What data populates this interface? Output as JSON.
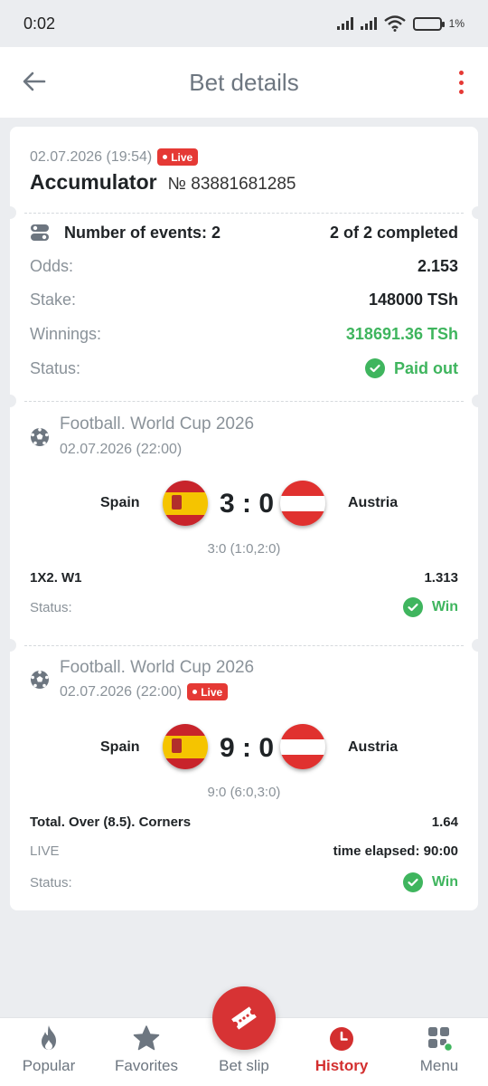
{
  "status_bar": {
    "time": "0:02",
    "battery": "1%"
  },
  "header": {
    "title": "Bet details"
  },
  "bet": {
    "datetime": "02.07.2026 (19:54)",
    "live_label": "Live",
    "type": "Accumulator",
    "number": "№ 83881681285",
    "events_label": "Number of events: 2",
    "completed": "2 of 2 completed",
    "odds_label": "Odds:",
    "odds": "2.153",
    "stake_label": "Stake:",
    "stake": "148000 TSh",
    "winnings_label": "Winnings:",
    "winnings": "318691.36 TSh",
    "status_label": "Status:",
    "status": "Paid out"
  },
  "events": [
    {
      "league": "Football. World Cup 2026",
      "datetime": "02.07.2026 (22:00)",
      "home": "Spain",
      "away": "Austria",
      "score": "3 : 0",
      "detail": "3:0 (1:0,2:0)",
      "market": "1X2. W1",
      "odds": "1.313",
      "status_label": "Status:",
      "status": "Win"
    },
    {
      "league": "Football. World Cup 2026",
      "datetime": "02.07.2026 (22:00)",
      "live_label": "Live",
      "home": "Spain",
      "away": "Austria",
      "score": "9 : 0",
      "detail": "9:0 (6:0,3:0)",
      "market": "Total. Over (8.5). Corners",
      "odds": "1.64",
      "live_text": "LIVE",
      "elapsed": "time elapsed: 90:00",
      "status_label": "Status:",
      "status": "Win"
    }
  ],
  "nav": {
    "popular": "Popular",
    "favorites": "Favorites",
    "betslip": "Bet slip",
    "history": "History",
    "menu": "Menu"
  },
  "colors": {
    "accent": "#d73334",
    "win": "#3fb55e",
    "live": "#e53935"
  }
}
